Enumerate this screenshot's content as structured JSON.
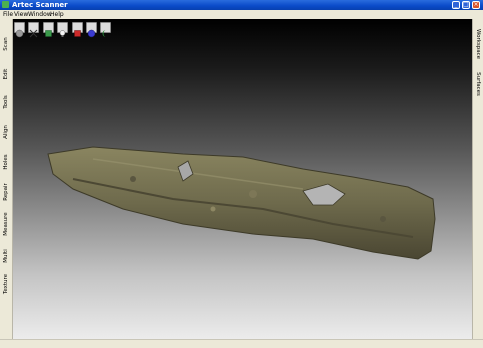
{
  "window": {
    "title": "Artec Scanner"
  },
  "menu": {
    "items": [
      "File",
      "View",
      "Window",
      "Help"
    ]
  },
  "left_tabs": [
    "Scan",
    "Edit",
    "Tools",
    "Align",
    "Holes",
    "Repair",
    "Measure",
    "Multi",
    "Texture"
  ],
  "right_tabs": [
    "Workspace",
    "Surfaces"
  ],
  "toolbar": {
    "buttons": [
      {
        "icon": "sphere-view-icon",
        "color": "#b0b0b0"
      },
      {
        "icon": "axes-icon",
        "color": "#d0d0d0"
      },
      {
        "icon": "green-cube-icon",
        "color": "#3a9a4a"
      },
      {
        "icon": "light-bulb-icon",
        "color": "#e8e8e8"
      },
      {
        "icon": "red-cube-icon",
        "color": "#cc2a2a"
      },
      {
        "icon": "blue-sphere-icon",
        "color": "#3a3ad0"
      },
      {
        "icon": "green-crescent-icon",
        "color": "#2a8a3a"
      }
    ]
  },
  "colors": {
    "titlebar": "#0a4ac8",
    "panel": "#ece9d8",
    "object": "#6b6648"
  }
}
